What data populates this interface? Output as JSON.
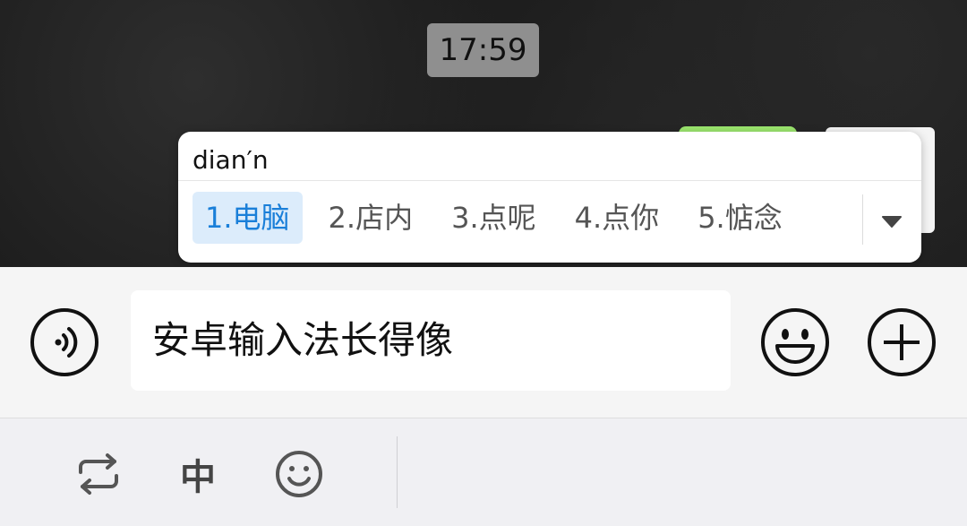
{
  "chat": {
    "time": "17:59"
  },
  "ime": {
    "composition": "dian′n",
    "candidates": [
      {
        "label": "1.电脑",
        "selected": true
      },
      {
        "label": "2.店内",
        "selected": false
      },
      {
        "label": "3.点呢",
        "selected": false
      },
      {
        "label": "4.点你",
        "selected": false
      },
      {
        "label": "5.惦念",
        "selected": false
      }
    ],
    "expand_icon": "triangle-down-icon",
    "selected_color": "#1a7fd9"
  },
  "input_bar": {
    "voice_icon": "voice-icon",
    "text_value": "安卓输入法长得像",
    "emoji_icon": "emoji-icon",
    "more_icon": "plus-icon"
  },
  "keyboard_toolbar": {
    "switch_icon": "switch-icon",
    "language_label": "中",
    "emoji_icon": "smiley-icon"
  }
}
